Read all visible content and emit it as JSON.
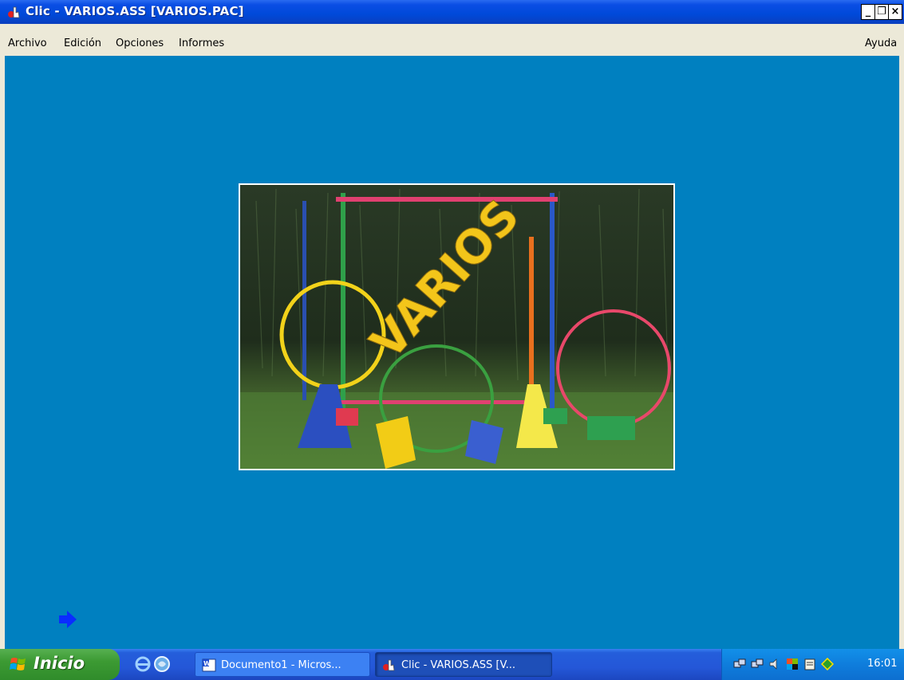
{
  "window": {
    "title": "Clic - VARIOS.ASS [VARIOS.PAC]",
    "buttons": {
      "minimize": "_",
      "restore": "❐",
      "close": "×"
    }
  },
  "menu": {
    "items": [
      "Archivo",
      "Edición",
      "Opciones",
      "Informes"
    ],
    "help": "Ayuda"
  },
  "stage": {
    "background_color": "#0080c0",
    "cover_text": "VARIOS",
    "next_icon": "next-arrow-icon"
  },
  "taskbar": {
    "start_label": "Inicio",
    "quick_launch": [
      "internet-explorer-icon",
      "browser-icon"
    ],
    "tasks": [
      {
        "label": "Documento1 - Micros...",
        "icon": "word-icon"
      },
      {
        "label": "Clic - VARIOS.ASS [V...",
        "icon": "clic-app-icon"
      }
    ],
    "tray_icons": [
      "network-icon",
      "network-icon",
      "volume-icon",
      "flag-icon",
      "notepad-icon",
      "antivirus-icon"
    ],
    "clock": "16:01"
  }
}
